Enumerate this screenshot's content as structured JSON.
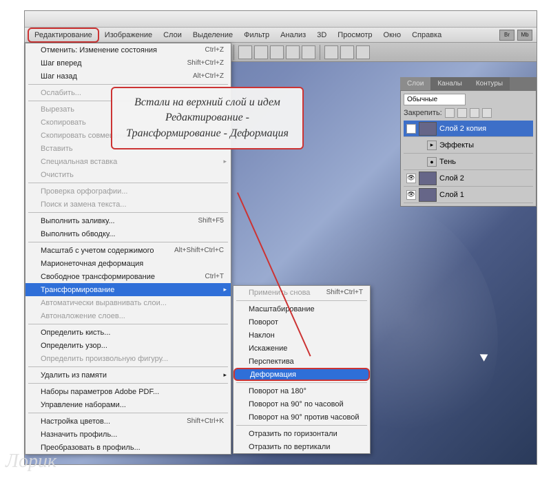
{
  "menubar": [
    "Редактирование",
    "Изображение",
    "Слои",
    "Выделение",
    "Фильтр",
    "Анализ",
    "3D",
    "Просмотр",
    "Окно",
    "Справка"
  ],
  "mb_right": [
    "Br",
    "Mb"
  ],
  "edit_menu": [
    {
      "t": "item",
      "label": "Отменить: Изменение состояния",
      "sc": "Ctrl+Z"
    },
    {
      "t": "item",
      "label": "Шаг вперед",
      "sc": "Shift+Ctrl+Z"
    },
    {
      "t": "item",
      "label": "Шаг назад",
      "sc": "Alt+Ctrl+Z"
    },
    {
      "t": "sep"
    },
    {
      "t": "item",
      "label": "Ослабить...",
      "disabled": true
    },
    {
      "t": "sep"
    },
    {
      "t": "item",
      "label": "Вырезать",
      "disabled": true
    },
    {
      "t": "item",
      "label": "Скопировать",
      "disabled": true
    },
    {
      "t": "item",
      "label": "Скопировать совмещенные данные",
      "disabled": true
    },
    {
      "t": "item",
      "label": "Вставить",
      "disabled": true
    },
    {
      "t": "item",
      "label": "Специальная вставка",
      "disabled": true,
      "arrow": true
    },
    {
      "t": "item",
      "label": "Очистить",
      "disabled": true
    },
    {
      "t": "sep"
    },
    {
      "t": "item",
      "label": "Проверка орфографии...",
      "disabled": true
    },
    {
      "t": "item",
      "label": "Поиск и замена текста...",
      "disabled": true
    },
    {
      "t": "sep"
    },
    {
      "t": "item",
      "label": "Выполнить заливку...",
      "sc": "Shift+F5"
    },
    {
      "t": "item",
      "label": "Выполнить обводку..."
    },
    {
      "t": "sep"
    },
    {
      "t": "item",
      "label": "Масштаб с учетом содержимого",
      "sc": "Alt+Shift+Ctrl+C"
    },
    {
      "t": "item",
      "label": "Марионеточная деформация"
    },
    {
      "t": "item",
      "label": "Свободное трансформирование",
      "sc": "Ctrl+T"
    },
    {
      "t": "item",
      "label": "Трансформирование",
      "sel": true,
      "arrow": true
    },
    {
      "t": "item",
      "label": "Автоматически выравнивать слои...",
      "disabled": true
    },
    {
      "t": "item",
      "label": "Автоналожение слоев...",
      "disabled": true
    },
    {
      "t": "sep"
    },
    {
      "t": "item",
      "label": "Определить кисть..."
    },
    {
      "t": "item",
      "label": "Определить узор..."
    },
    {
      "t": "item",
      "label": "Определить произвольную фигуру...",
      "disabled": true
    },
    {
      "t": "sep"
    },
    {
      "t": "item",
      "label": "Удалить из памяти",
      "arrow": true
    },
    {
      "t": "sep"
    },
    {
      "t": "item",
      "label": "Наборы параметров Adobe PDF..."
    },
    {
      "t": "item",
      "label": "Управление наборами..."
    },
    {
      "t": "sep"
    },
    {
      "t": "item",
      "label": "Настройка цветов...",
      "sc": "Shift+Ctrl+K"
    },
    {
      "t": "item",
      "label": "Назначить профиль..."
    },
    {
      "t": "item",
      "label": "Преобразовать в профиль..."
    }
  ],
  "transform_submenu": [
    {
      "t": "item",
      "label": "Применить снова",
      "sc": "Shift+Ctrl+T",
      "disabled": true
    },
    {
      "t": "sep"
    },
    {
      "t": "item",
      "label": "Масштабирование"
    },
    {
      "t": "item",
      "label": "Поворот"
    },
    {
      "t": "item",
      "label": "Наклон"
    },
    {
      "t": "item",
      "label": "Искажение"
    },
    {
      "t": "item",
      "label": "Перспектива"
    },
    {
      "t": "item",
      "label": "Деформация",
      "sel": true,
      "boxed": true
    },
    {
      "t": "sep"
    },
    {
      "t": "item",
      "label": "Поворот на 180°"
    },
    {
      "t": "item",
      "label": "Поворот на 90° по часовой"
    },
    {
      "t": "item",
      "label": "Поворот на 90° против часовой"
    },
    {
      "t": "sep"
    },
    {
      "t": "item",
      "label": "Отразить по горизонтали"
    },
    {
      "t": "item",
      "label": "Отразить по вертикали"
    }
  ],
  "panels": {
    "tabs": [
      "Слои",
      "Каналы",
      "Контуры"
    ],
    "mode": "Обычные",
    "lock_label": "Закрепить:",
    "layers": [
      {
        "name": "Слой 2 копия",
        "sel": true
      },
      {
        "name": "Эффекты",
        "sub": true,
        "bullet": "▸"
      },
      {
        "name": "Тень",
        "sub": true,
        "bullet": "●"
      },
      {
        "name": "Слой 2"
      },
      {
        "name": "Слой 1"
      }
    ]
  },
  "annotation": "Встали на верхний слой и идем Редактирование - Трансформирование - Деформация",
  "watermark": "Лорик"
}
